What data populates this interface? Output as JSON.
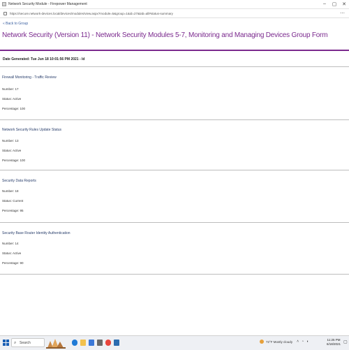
{
  "window": {
    "title": "Network Security Module - Firepower Management",
    "minimize": "–",
    "maximize": "▢",
    "close": "✕"
  },
  "browser": {
    "url": "https://secure.network-devices.local/devices/modules/view.aspx?module=5&group=1&id=27&tab=all#status-summary",
    "menu": "⋯"
  },
  "page": {
    "backlink": "« Back to Group",
    "title": "Network Security (Version 11) - Network Security Modules 5-7, Monitoring and Managing Devices Group Form",
    "meta": "Date Generated: Tue Jun 18 10:01:56 PM 2021 - ld"
  },
  "modules": [
    {
      "name": "Firewall Monitoring - Traffic Review",
      "lines": [
        "Number: 17",
        "Status: Active",
        "Percentage: 100"
      ]
    },
    {
      "name": "Network Security Rules Update Status",
      "lines": [
        "Number: 13",
        "Status: Active",
        "Percentage: 100"
      ]
    },
    {
      "name": "Security Data Reports",
      "lines": [
        "Number: 18",
        "Status: Current",
        "Percentage: 95"
      ]
    },
    {
      "name": "Security Base Router Identity Authentication",
      "lines": [
        "Number: 14",
        "Status: Active",
        "Percentage: 90"
      ]
    }
  ],
  "taskbar": {
    "search_label": "Search",
    "search_icon": "⌕",
    "tray_text": "72°F  Mostly cloudy",
    "time": "11:25 PM",
    "date": "6/18/2021",
    "notification_icon": "▢"
  },
  "colors": {
    "accent": "#7b2a8e",
    "link": "#3a5fa0",
    "module_title": "#2a3f6c"
  }
}
